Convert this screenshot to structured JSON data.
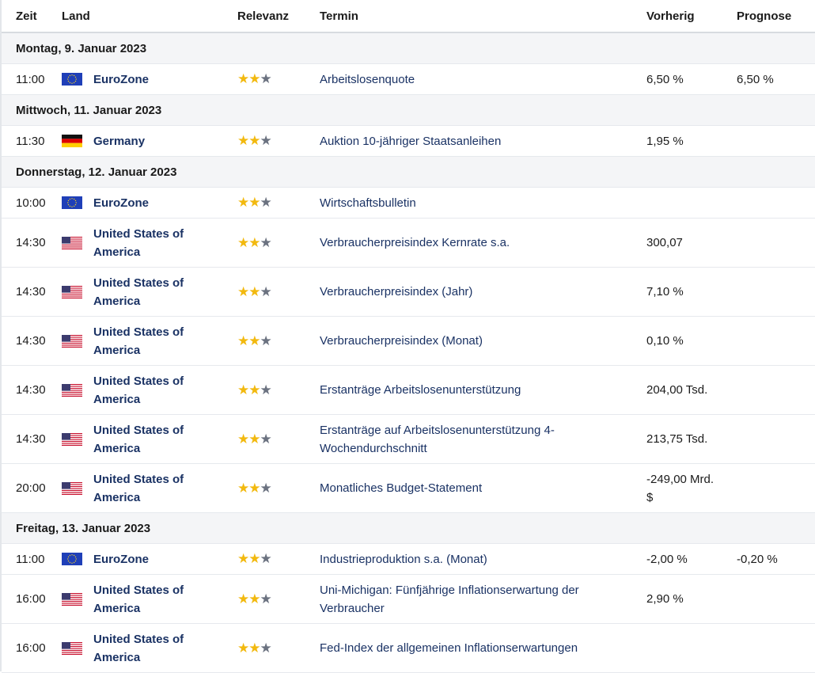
{
  "columns": [
    "Zeit",
    "Land",
    "Relevanz",
    "Termin",
    "Vorherig",
    "Prognose"
  ],
  "colors": {
    "star_on": "#f2b90f",
    "star_off": "#6b7280",
    "link": "#1a3264"
  },
  "days": [
    {
      "label": "Montag, 9. Januar 2023",
      "events": [
        {
          "time": "11:00",
          "flag": "eu-flag-icon",
          "country": "EuroZone",
          "stars": 2,
          "termin": "Arbeitslosenquote",
          "vorherig": "6,50 %",
          "prognose": "6,50 %"
        }
      ]
    },
    {
      "label": "Mittwoch, 11. Januar 2023",
      "events": [
        {
          "time": "11:30",
          "flag": "de-flag-icon",
          "country": "Germany",
          "stars": 2,
          "termin": "Auktion 10-jähriger Staatsanleihen",
          "vorherig": "1,95 %",
          "prognose": ""
        }
      ]
    },
    {
      "label": "Donnerstag, 12. Januar 2023",
      "events": [
        {
          "time": "10:00",
          "flag": "eu-flag-icon",
          "country": "EuroZone",
          "stars": 2,
          "termin": "Wirtschaftsbulletin",
          "vorherig": "",
          "prognose": ""
        },
        {
          "time": "14:30",
          "flag": "us-flag-icon",
          "country": "United States of America",
          "stars": 2,
          "termin": "Verbraucherpreisindex Kernrate s.a.",
          "vorherig": "300,07",
          "prognose": ""
        },
        {
          "time": "14:30",
          "flag": "us-flag-icon",
          "country": "United States of America",
          "stars": 2,
          "termin": "Verbraucherpreisindex (Jahr)",
          "vorherig": "7,10 %",
          "prognose": ""
        },
        {
          "time": "14:30",
          "flag": "us-flag-icon",
          "country": "United States of America",
          "stars": 2,
          "termin": "Verbraucherpreisindex (Monat)",
          "vorherig": "0,10 %",
          "prognose": ""
        },
        {
          "time": "14:30",
          "flag": "us-flag-icon",
          "country": "United States of America",
          "stars": 2,
          "termin": "Erstanträge Arbeitslosenunterstützung",
          "vorherig": "204,00 Tsd.",
          "prognose": ""
        },
        {
          "time": "14:30",
          "flag": "us-flag-icon",
          "country": "United States of America",
          "stars": 2,
          "termin": "Erstanträge auf Arbeitslosenunterstützung 4-Wochendurchschnitt",
          "vorherig": "213,75 Tsd.",
          "prognose": ""
        },
        {
          "time": "20:00",
          "flag": "us-flag-icon",
          "country": "United States of America",
          "stars": 2,
          "termin": "Monatliches Budget-Statement",
          "vorherig": "-249,00 Mrd. $",
          "prognose": ""
        }
      ]
    },
    {
      "label": "Freitag, 13. Januar 2023",
      "events": [
        {
          "time": "11:00",
          "flag": "eu-flag-icon",
          "country": "EuroZone",
          "stars": 2,
          "termin": "Industrieproduktion s.a. (Monat)",
          "vorherig": "-2,00 %",
          "prognose": "-0,20 %"
        },
        {
          "time": "16:00",
          "flag": "us-flag-icon",
          "country": "United States of America",
          "stars": 2,
          "termin": "Uni-Michigan: Fünfjährige Inflationserwartung der Verbraucher",
          "vorherig": "2,90 %",
          "prognose": ""
        },
        {
          "time": "16:00",
          "flag": "us-flag-icon",
          "country": "United States of America",
          "stars": 2,
          "termin": "Fed-Index der allgemeinen Inflationserwartungen",
          "vorherig": "",
          "prognose": ""
        }
      ]
    }
  ]
}
